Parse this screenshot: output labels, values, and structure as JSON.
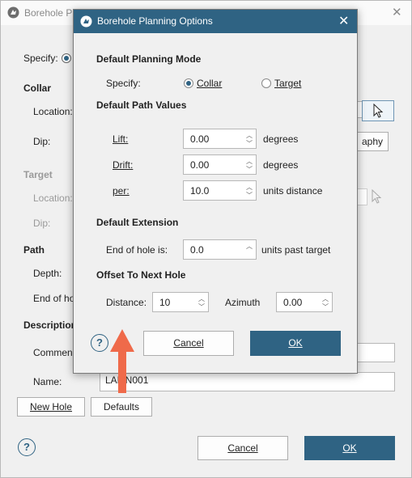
{
  "background": {
    "title": "Borehole Pl",
    "specify_label": "Specify:",
    "collar_section": "Collar",
    "collar_location_label": "Location:",
    "collar_dip_label": "Dip:",
    "topography_button_fragment": "aphy",
    "target_section": "Target",
    "target_location_label": "Location:",
    "target_dip_label": "Dip:",
    "path_section": "Path",
    "depth_label": "Depth:",
    "end_of_hole_label": "End of ho",
    "description_section": "Description",
    "comment_label": "Commen",
    "name_label": "Name:",
    "name_value": "LAMN001",
    "new_hole_button": "New Hole",
    "defaults_button": "Defaults",
    "cancel_button": "Cancel",
    "ok_button": "OK",
    "help": "?"
  },
  "dialog": {
    "title": "Borehole Planning Options",
    "planning_mode_section": "Default Planning Mode",
    "specify_label": "Specify:",
    "option_collar": "Collar",
    "option_target": "Target",
    "selected_option": "Collar",
    "path_values_section": "Default Path Values",
    "lift_label": "Lift:",
    "lift_value": "0.00",
    "lift_unit": "degrees",
    "drift_label": "Drift:",
    "drift_value": "0.00",
    "drift_unit": "degrees",
    "per_label": "per:",
    "per_value": "10.0",
    "per_unit": "units distance",
    "extension_section": "Default Extension",
    "end_of_hole_label": "End of hole is:",
    "end_of_hole_value": "0.0",
    "end_of_hole_unit": "units past target",
    "offset_section": "Offset To Next Hole",
    "distance_label": "Distance:",
    "distance_value": "10",
    "azimuth_label": "Azimuth",
    "azimuth_value": "0.00",
    "help": "?",
    "cancel_button": "Cancel",
    "ok_button": "OK"
  },
  "colors": {
    "accent": "#2f6383",
    "annotation_arrow": "#ef6a4a"
  }
}
